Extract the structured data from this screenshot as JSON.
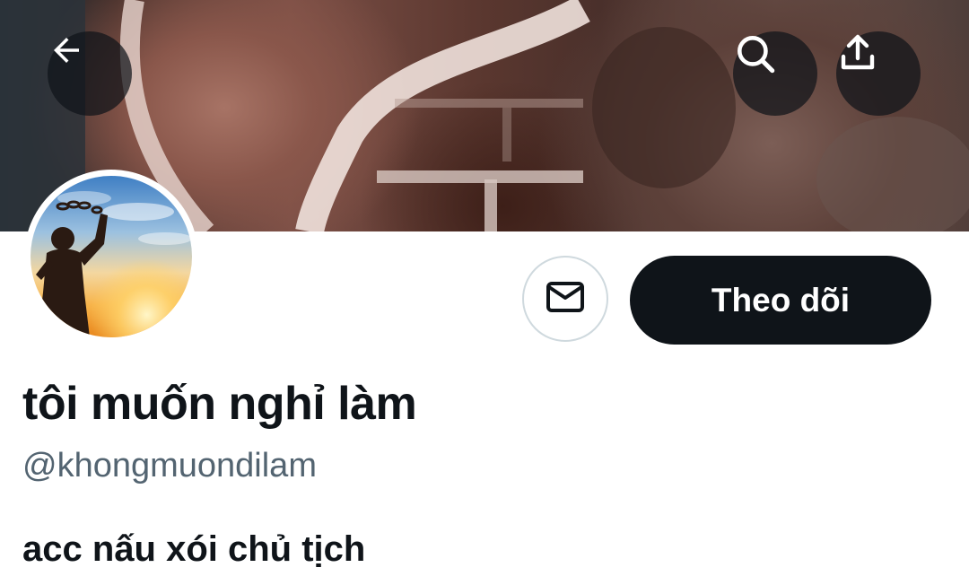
{
  "header": {
    "back_icon": "arrow-left-icon",
    "search_icon": "search-icon",
    "share_icon": "share-upload-icon"
  },
  "profile": {
    "display_name": "tôi muốn nghỉ làm",
    "handle": "@khongmuondilam",
    "bio": "acc nấu xói chủ tịch",
    "follow_label": "Theo dõi",
    "message_icon": "envelope-icon",
    "avatar_description_icon": "avatar-sunset-silhouette"
  },
  "colors": {
    "follow_button_bg": "#0f1419",
    "follow_button_text": "#ffffff",
    "primary_text": "#0f1419",
    "secondary_text": "#536471",
    "border": "#cfd9de"
  }
}
